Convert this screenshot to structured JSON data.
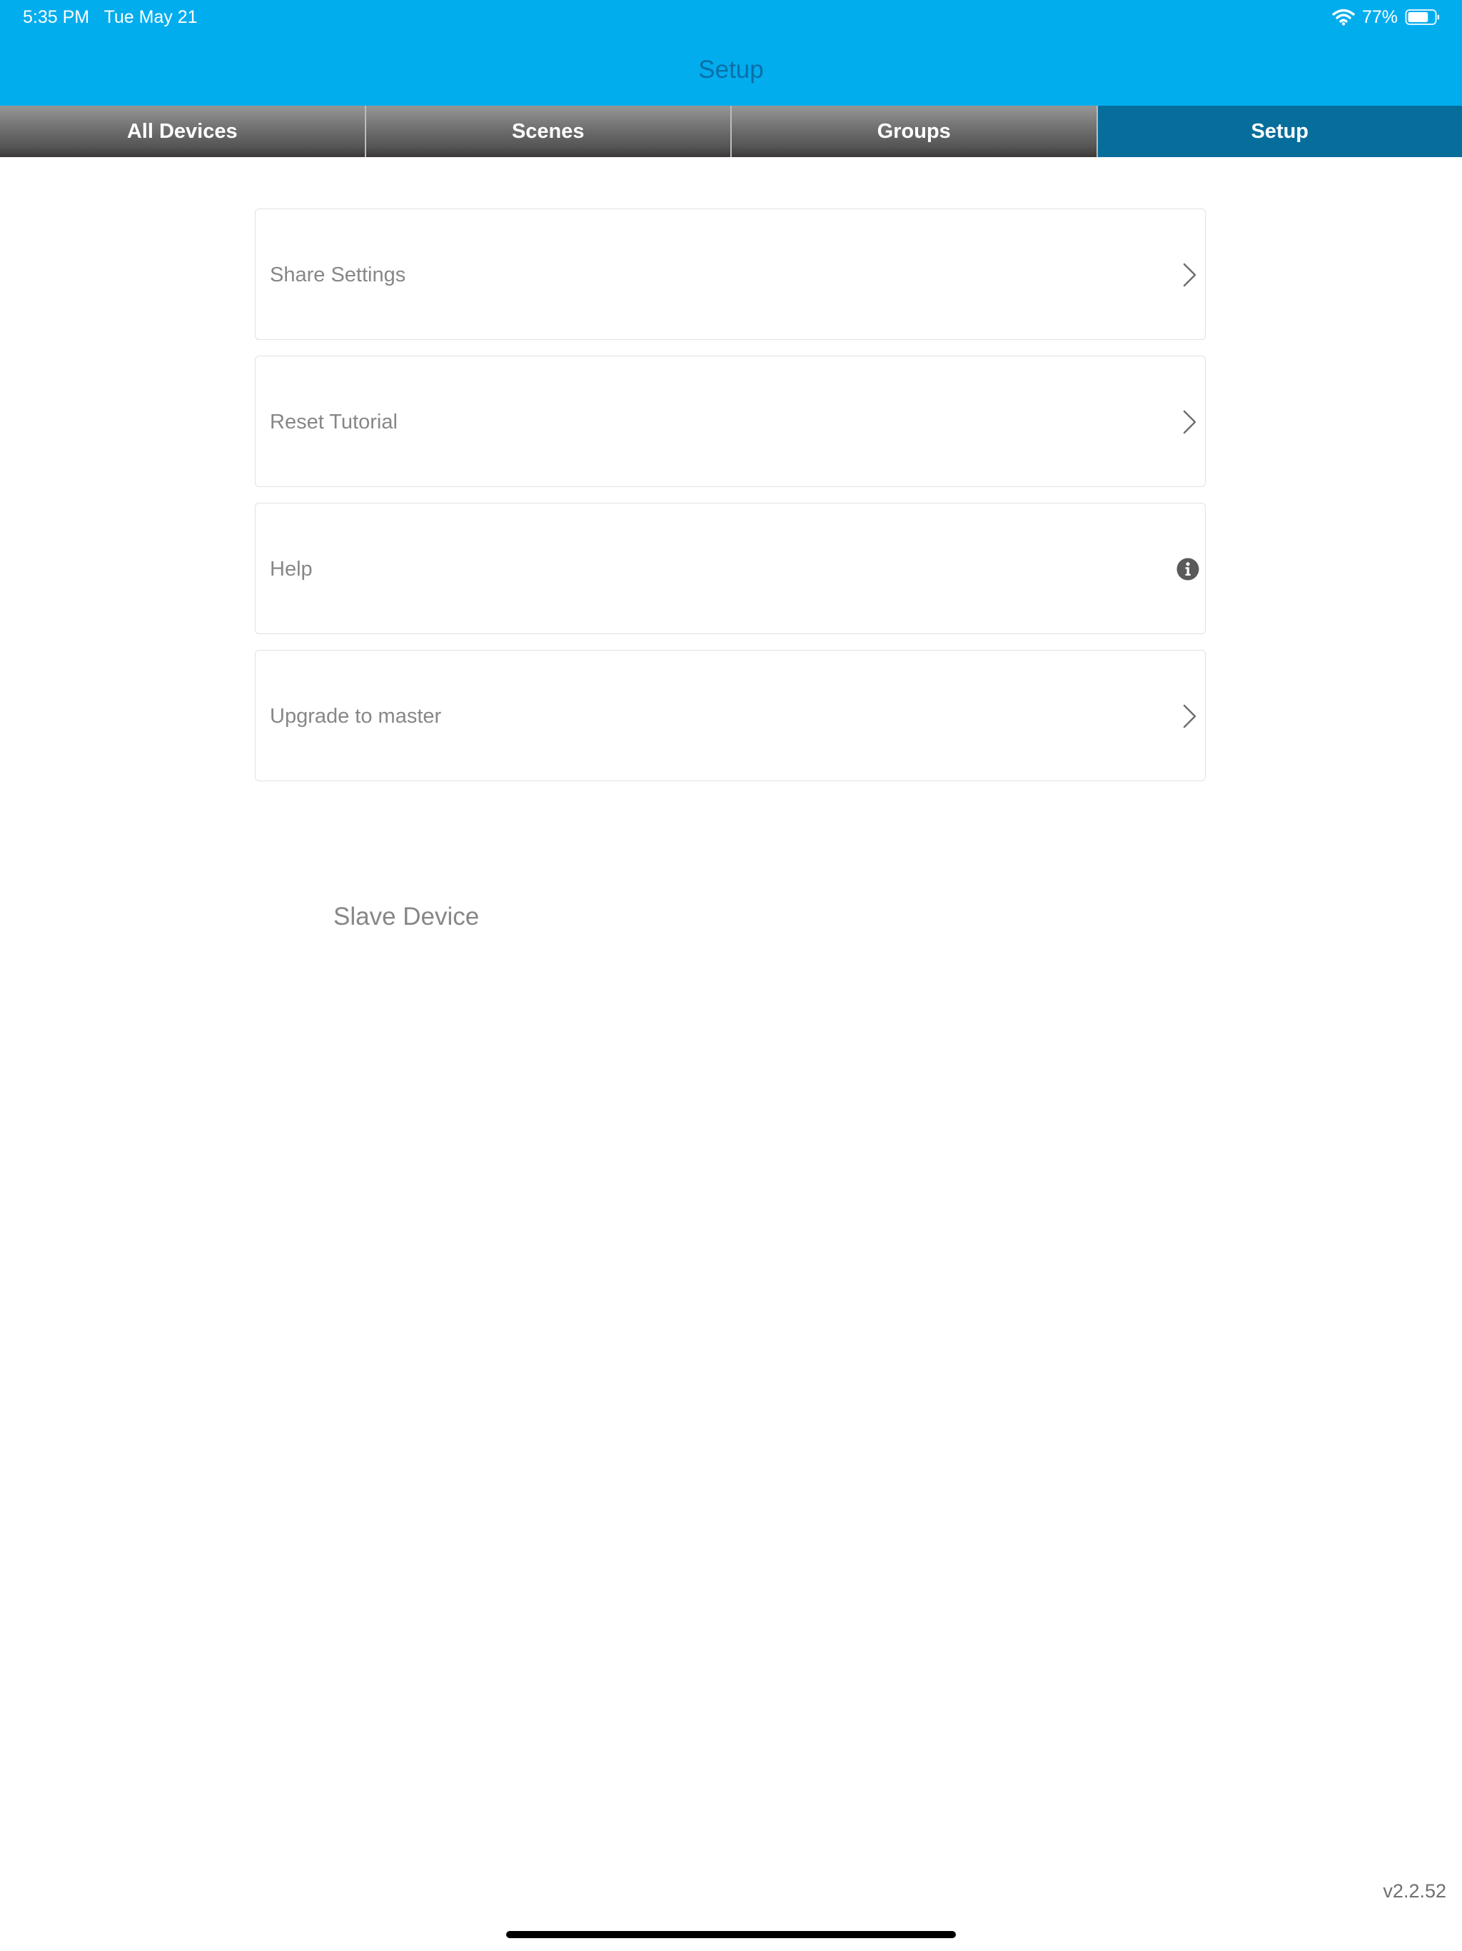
{
  "status_bar": {
    "time": "5:35 PM   Tue May 21",
    "battery_percent": "77%",
    "battery_level": 0.77,
    "icons": [
      "wifi-icon",
      "battery-icon"
    ]
  },
  "header": {
    "title": "Setup",
    "background_color": "#02ADEE",
    "title_color": "#0A6FA8"
  },
  "tabs": [
    {
      "label": "All Devices",
      "active": false
    },
    {
      "label": "Scenes",
      "active": false
    },
    {
      "label": "Groups",
      "active": false
    },
    {
      "label": "Setup",
      "active": true
    }
  ],
  "tab_active_color": "#076E9C",
  "settings": [
    {
      "label": "Share Settings",
      "icon": "chevron-right-icon"
    },
    {
      "label": "Reset Tutorial",
      "icon": "chevron-right-icon"
    },
    {
      "label": "Help",
      "icon": "info-icon"
    },
    {
      "label": "Upgrade to master",
      "icon": "chevron-right-icon"
    }
  ],
  "device_role": "Slave Device",
  "version": "v2.2.52"
}
